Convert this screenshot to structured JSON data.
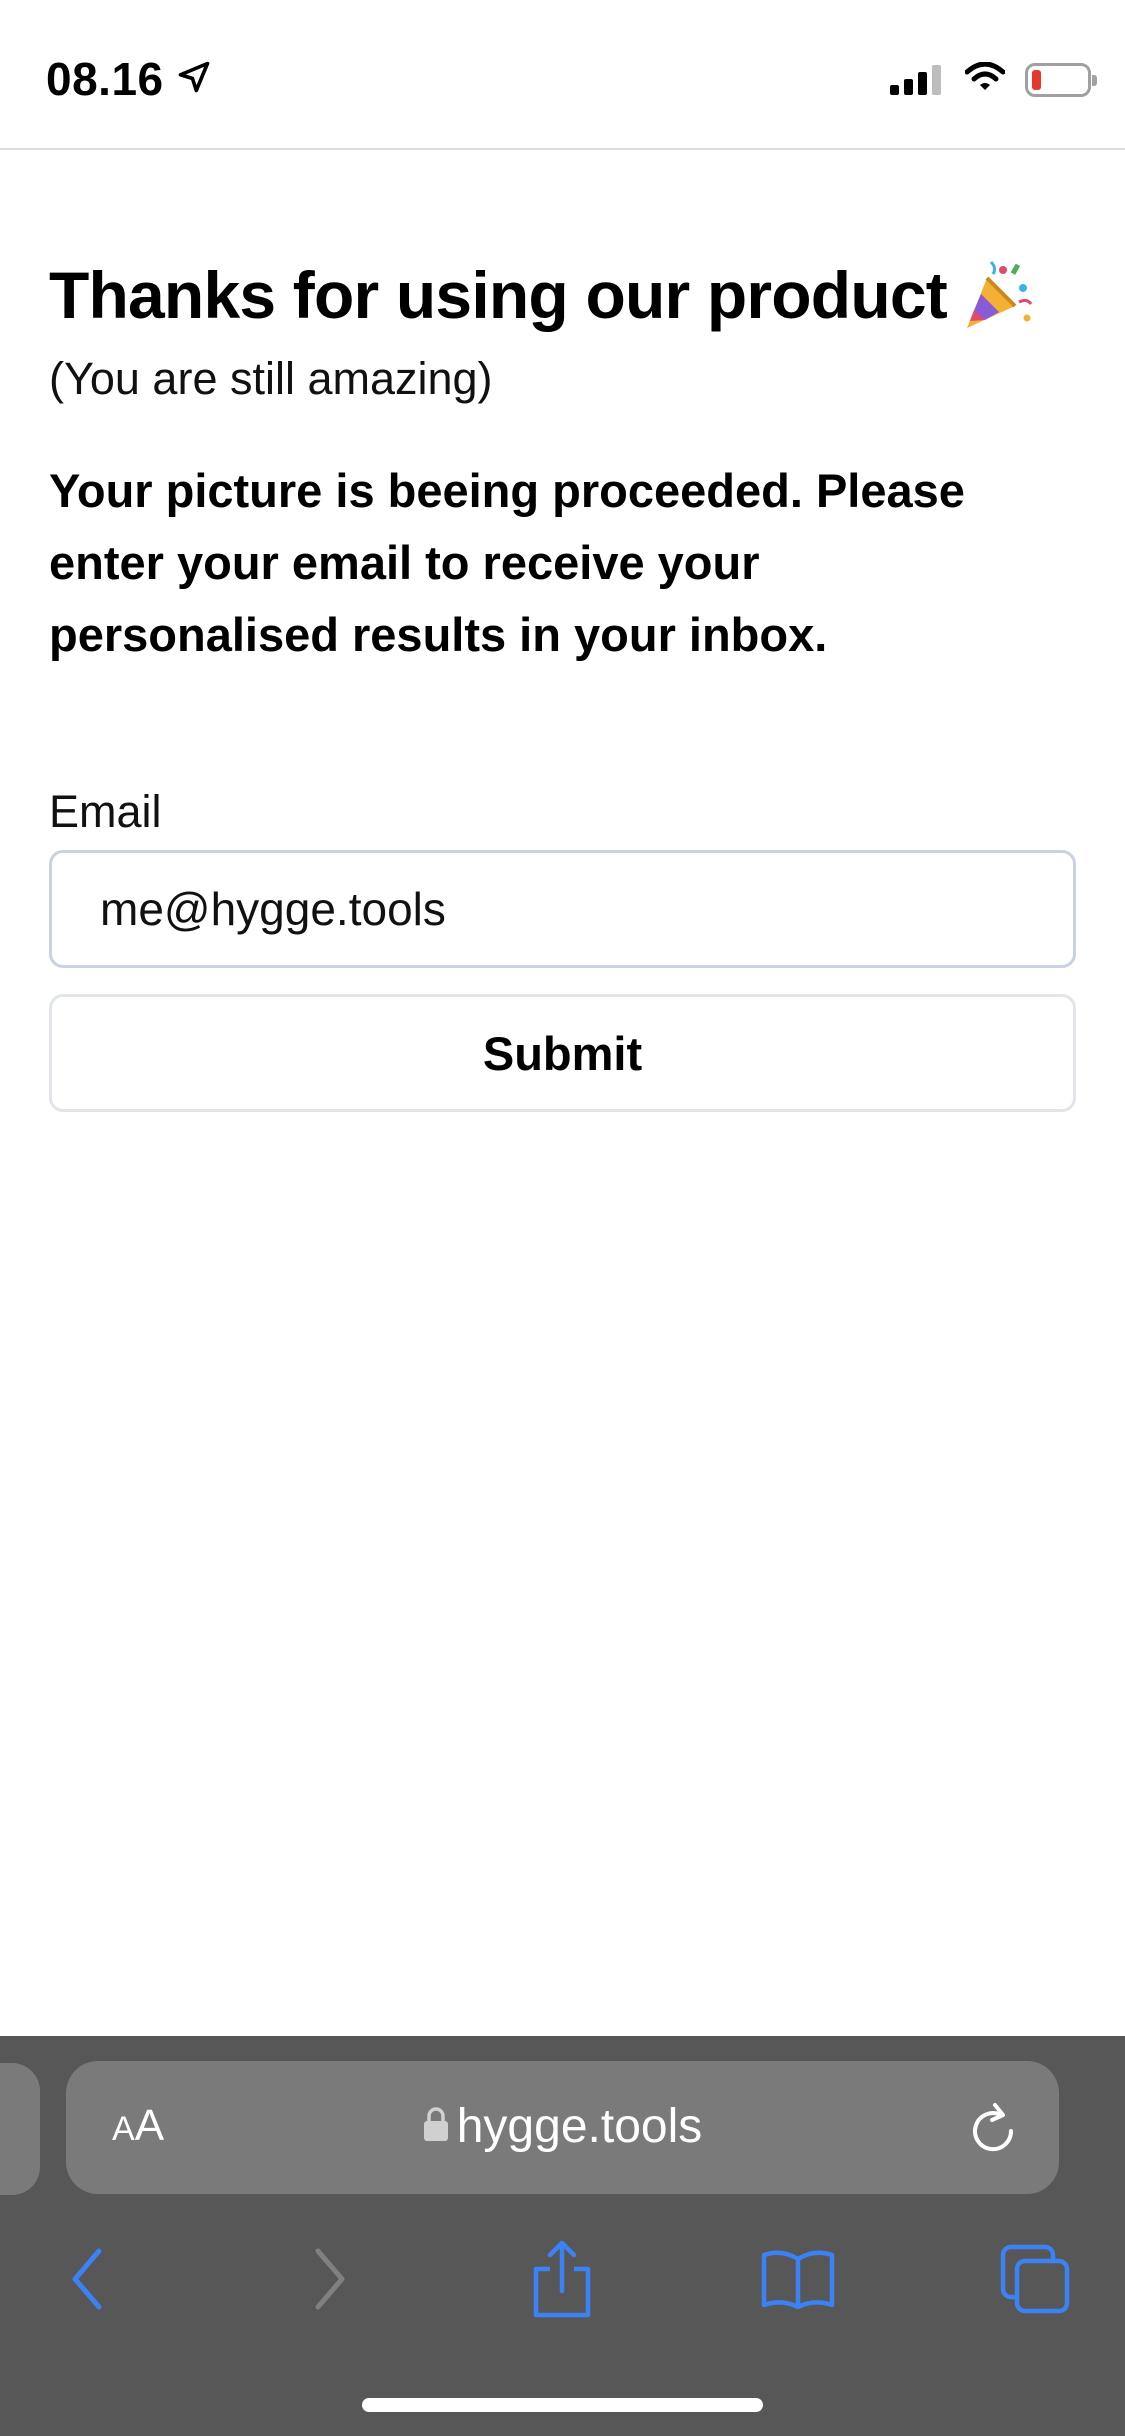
{
  "status_bar": {
    "time": "08.16",
    "icons": [
      "location-arrow-icon",
      "cellular-signal-icon",
      "wifi-icon",
      "battery-low-icon"
    ],
    "battery_color": "#e5372d"
  },
  "page": {
    "title": "Thanks for using our product",
    "title_emoji": "party-popper-icon",
    "subtitle": "(You are still amazing)",
    "message": "Your picture is beeing proceeded. Please enter your email to receive your personalised results in your inbox."
  },
  "form": {
    "email_label": "Email",
    "email_value": "me@hygge.tools",
    "submit_label": "Submit"
  },
  "browser": {
    "aa_small": "A",
    "aa_large": "A",
    "url": "hygge.tools",
    "accent_color": "#3b82f6",
    "nav_icons": [
      "back-icon",
      "forward-icon",
      "share-icon",
      "bookmarks-icon",
      "tabs-icon"
    ]
  }
}
